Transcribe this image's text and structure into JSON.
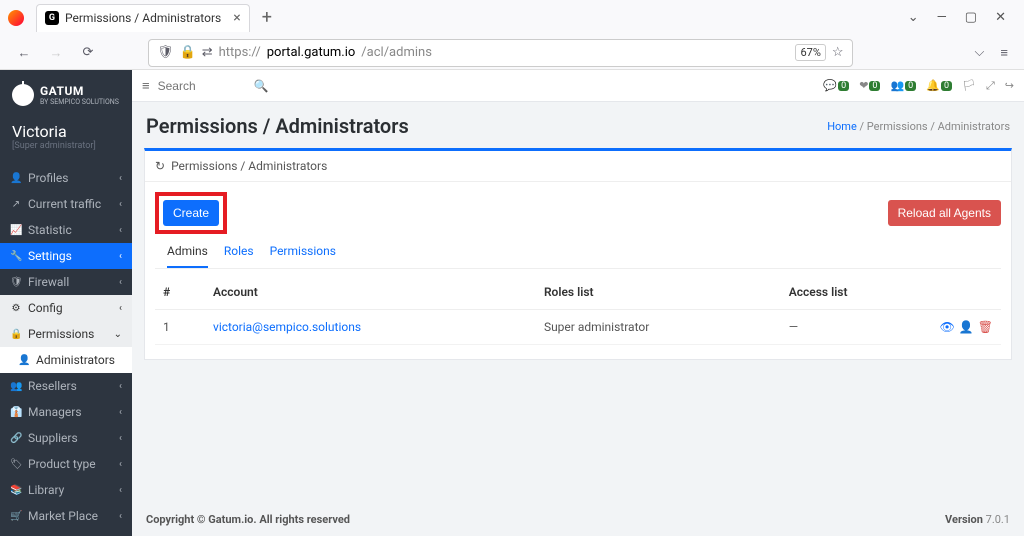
{
  "browser": {
    "tab_title": "Permissions / Administrators",
    "url_prefix": "https://",
    "url_host": "portal.gatum.io",
    "url_path": "/acl/admins",
    "zoom": "67%"
  },
  "brand": {
    "name": "GATUM",
    "sub": "BY SEMPICO SOLUTIONS"
  },
  "user": {
    "name": "Victoria",
    "role": "[Super administrator]"
  },
  "sidebar": {
    "items": [
      {
        "label": "Profiles",
        "icon": "👤",
        "expandable": true
      },
      {
        "label": "Current traffic",
        "icon": "↗",
        "expandable": true
      },
      {
        "label": "Statistic",
        "icon": "📈",
        "expandable": true
      },
      {
        "label": "Settings",
        "icon": "🔧",
        "expandable": true,
        "active": true
      },
      {
        "label": "Firewall",
        "icon": "🛡",
        "expandable": true
      },
      {
        "label": "Config",
        "icon": "⚙",
        "expandable": true,
        "light": true
      },
      {
        "label": "Permissions",
        "icon": "🔒",
        "expandable": true,
        "light": true,
        "open": true
      },
      {
        "label": "Resellers",
        "icon": "👥",
        "expandable": true
      },
      {
        "label": "Managers",
        "icon": "👔",
        "expandable": true
      },
      {
        "label": "Suppliers",
        "icon": "🔗",
        "expandable": true
      },
      {
        "label": "Product type",
        "icon": "🏷",
        "expandable": true
      },
      {
        "label": "Library",
        "icon": "📚",
        "expandable": true
      },
      {
        "label": "Market Place",
        "icon": "🛒",
        "expandable": true
      }
    ],
    "sub_permissions": [
      {
        "label": "Administrators",
        "selected": true
      }
    ]
  },
  "topbar": {
    "search_placeholder": "Search",
    "badges": [
      {
        "icon": "💬",
        "count": "0"
      },
      {
        "icon": "❤",
        "count": "0"
      },
      {
        "icon": "👥",
        "count": "0"
      },
      {
        "icon": "🔔",
        "count": "0"
      }
    ]
  },
  "page": {
    "title": "Permissions / Administrators",
    "crumb_home": "Home",
    "crumb_sep": " / ",
    "crumb_current": "Permissions / Administrators",
    "panel_title": "Permissions / Administrators",
    "create_label": "Create",
    "reload_label": "Reload all Agents",
    "tabs": [
      {
        "label": "Admins",
        "active": true
      },
      {
        "label": "Roles"
      },
      {
        "label": "Permissions"
      }
    ],
    "columns": {
      "num": "#",
      "account": "Account",
      "roles": "Roles list",
      "access": "Access list",
      "actions": ""
    },
    "rows": [
      {
        "num": "1",
        "account": "victoria@sempico.solutions",
        "roles": "Super administrator",
        "access": "—"
      }
    ]
  },
  "footer": {
    "copyright": "Copyright © Gatum.io. All rights reserved",
    "version_label": "Version ",
    "version": "7.0.1"
  }
}
